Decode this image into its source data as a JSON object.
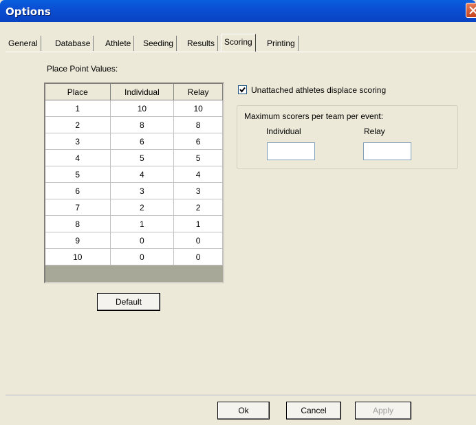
{
  "window": {
    "title": "Options"
  },
  "tabs": [
    {
      "label": "General"
    },
    {
      "label": "Database"
    },
    {
      "label": "Athlete"
    },
    {
      "label": "Seeding"
    },
    {
      "label": "Results"
    },
    {
      "label": "Scoring",
      "active": true
    },
    {
      "label": "Printing"
    }
  ],
  "scoring": {
    "place_values_label": "Place Point Values:",
    "columns": [
      "Place",
      "Individual",
      "Relay"
    ],
    "rows": [
      [
        "1",
        "10",
        "10"
      ],
      [
        "2",
        "8",
        "8"
      ],
      [
        "3",
        "6",
        "6"
      ],
      [
        "4",
        "5",
        "5"
      ],
      [
        "5",
        "4",
        "4"
      ],
      [
        "6",
        "3",
        "3"
      ],
      [
        "7",
        "2",
        "2"
      ],
      [
        "8",
        "1",
        "1"
      ],
      [
        "9",
        "0",
        "0"
      ],
      [
        "10",
        "0",
        "0"
      ]
    ],
    "default_button": "Default",
    "unattached_checkbox": {
      "label": "Unattached athletes displace scoring",
      "checked": true
    },
    "max_scorers": {
      "group_label": "Maximum scorers per team per event:",
      "individual_label": "Individual",
      "relay_label": "Relay",
      "individual_value": "",
      "relay_value": ""
    }
  },
  "buttons": {
    "ok": "Ok",
    "cancel": "Cancel",
    "apply": "Apply"
  },
  "colors": {
    "title_bar": "#0b4fd3",
    "dialog_bg": "#ece9d8",
    "grid_empty": "#a8a898"
  }
}
